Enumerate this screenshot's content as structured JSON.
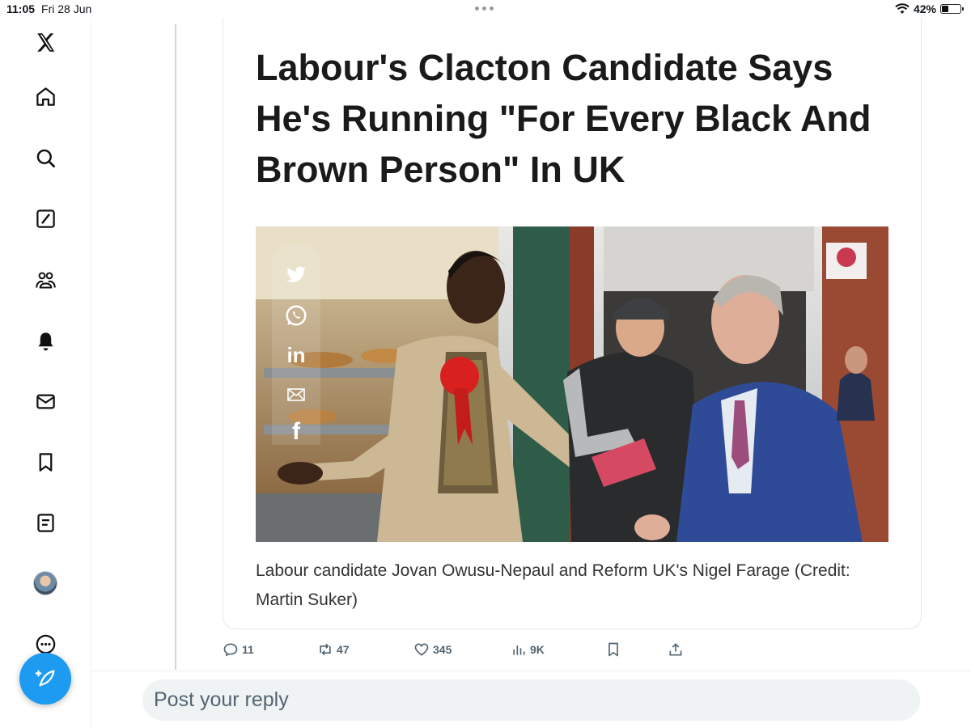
{
  "status_bar": {
    "time": "11:05",
    "date": "Fri 28 Jun",
    "battery": "42%",
    "battery_level": 0.42
  },
  "nav": {
    "items": [
      "x-logo",
      "home",
      "explore",
      "grok",
      "communities",
      "notifications",
      "messages",
      "bookmarks",
      "lists",
      "profile",
      "more"
    ]
  },
  "article": {
    "headline": "Labour's Clacton Candidate Says He's Running \"For Every Black And Brown Person\" In UK",
    "caption": "Labour candidate Jovan Owusu-Nepaul and Reform UK's Nigel Farage (Credit: Martin Suker)",
    "share_icons": [
      "twitter-icon",
      "whatsapp-icon",
      "linkedin-icon",
      "email-icon",
      "facebook-icon"
    ],
    "linkedin_label": "in",
    "facebook_label": "f"
  },
  "actions": {
    "replies": "11",
    "reposts": "47",
    "likes": "345",
    "views": "9K"
  },
  "reply": {
    "placeholder": "Post your reply"
  },
  "colors": {
    "accent": "#1d9bf0",
    "muted": "#536471",
    "rosette": "#d8201f"
  }
}
